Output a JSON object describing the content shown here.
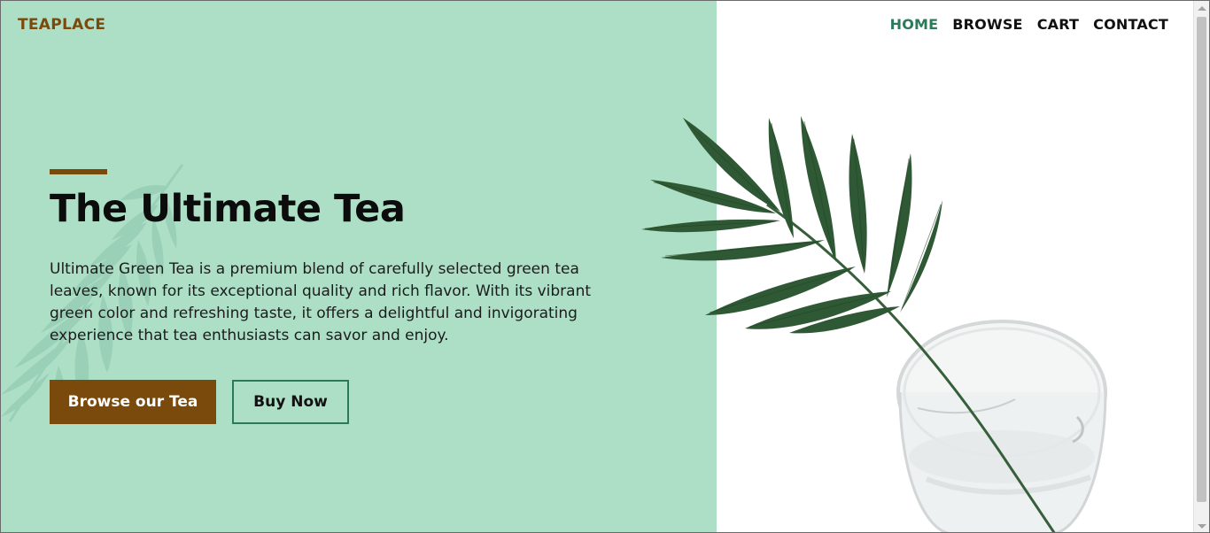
{
  "brand": {
    "logo": "TEAPLACE"
  },
  "nav": {
    "items": [
      {
        "label": "HOME",
        "active": true
      },
      {
        "label": "BROWSE",
        "active": false
      },
      {
        "label": "CART",
        "active": false
      },
      {
        "label": "CONTACT",
        "active": false
      }
    ]
  },
  "hero": {
    "title": "The Ultimate Tea",
    "description": "Ultimate Green Tea is a premium blend of carefully selected green tea leaves, known for its exceptional quality and rich flavor. With its vibrant green color and refreshing taste, it offers a delightful and invigorating experience that tea enthusiasts can savor and enjoy.",
    "primary_button": "Browse our Tea",
    "secondary_button": "Buy Now"
  },
  "colors": {
    "mint_background": "#acdfc6",
    "brand_brown": "#7a4a0c",
    "accent_green": "#2c7a59",
    "text_dark": "#0c0c0c"
  },
  "images": {
    "decor": "fern-silhouette",
    "hero_image": "palm-leaf-in-glass-cup"
  }
}
